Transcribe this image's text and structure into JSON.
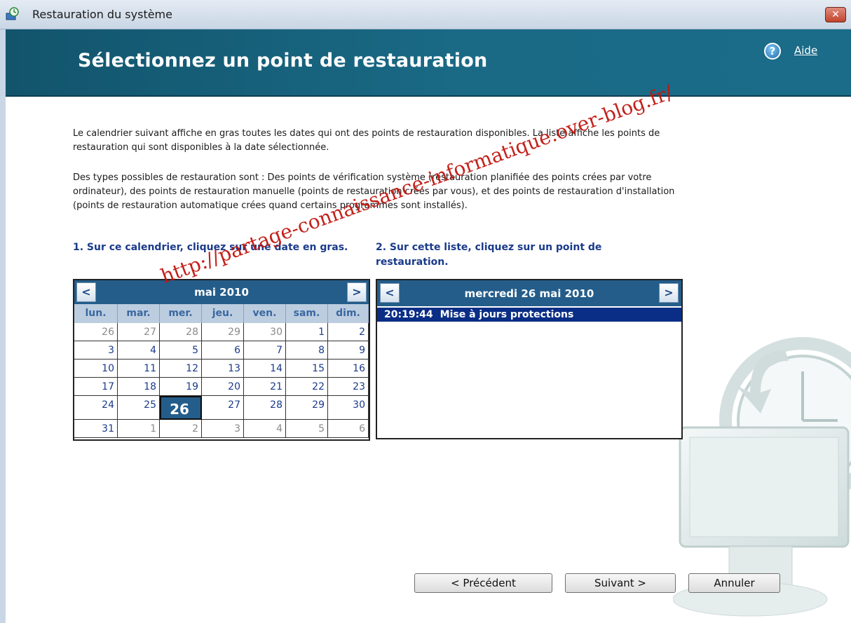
{
  "window": {
    "title": "Restauration du système",
    "close_label": "✕"
  },
  "header": {
    "title": "Sélectionnez un point de restauration",
    "help_label": "Aide"
  },
  "description": {
    "paragraph1": "Le calendrier suivant affiche en gras toutes les dates qui ont des points de restauration disponibles. La liste affiche les points de restauration qui sont disponibles à la date sélectionnée.",
    "paragraph2": "Des types possibles de restauration sont : Des points de vérification système (restauration planifiée des points crées par votre ordinateur), des points de restauration manuelle (points de restauration crées par vous), et des points de restauration d'installation (points de restauration automatique crées quand certains programmes sont installés)."
  },
  "step1_label": "1. Sur ce calendrier, cliquez sur une date en gras.",
  "step2_label": "2. Sur cette liste, cliquez sur un point de restauration.",
  "calendar": {
    "prev": "<",
    "next": ">",
    "month": "mai 2010",
    "weekdays": [
      "lun.",
      "mar.",
      "mer.",
      "jeu.",
      "ven.",
      "sam.",
      "dim."
    ],
    "weeks": [
      [
        "26",
        "27",
        "28",
        "29",
        "30",
        "1",
        "2"
      ],
      [
        "3",
        "4",
        "5",
        "6",
        "7",
        "8",
        "9"
      ],
      [
        "10",
        "11",
        "12",
        "13",
        "14",
        "15",
        "16"
      ],
      [
        "17",
        "18",
        "19",
        "20",
        "21",
        "22",
        "23"
      ],
      [
        "24",
        "25",
        "26",
        "27",
        "28",
        "29",
        "30"
      ],
      [
        "31",
        "1",
        "2",
        "3",
        "4",
        "5",
        "6"
      ]
    ],
    "selected": "26"
  },
  "restore_list": {
    "prev": "<",
    "next": ">",
    "date": "mercredi 26 mai 2010",
    "items": [
      {
        "time": "20:19:44",
        "description": "Mise à jours protections"
      }
    ]
  },
  "buttons": {
    "previous": "< Précédent",
    "next": "Suivant >",
    "cancel": "Annuler"
  },
  "watermark": "http://partage-connaissance-informatique.over-blog.fr/"
}
